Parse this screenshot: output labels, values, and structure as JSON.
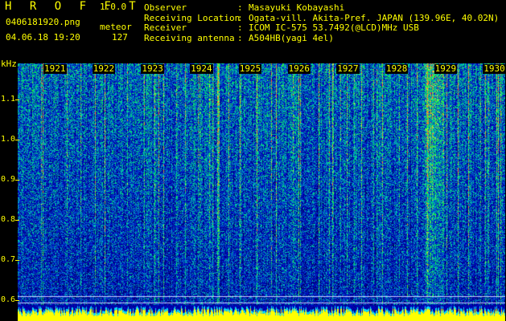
{
  "app": {
    "title": "H R O F F T",
    "version": "1.0.0"
  },
  "file": {
    "name": "0406181920.png",
    "datetime": "04.06.18 19:20",
    "mode": "meteor",
    "count": "127"
  },
  "info": [
    {
      "key": "Observer",
      "value": "Masayuki Kobayashi"
    },
    {
      "key": "Receiving Location",
      "value": "Ogata-vill. Akita-Pref. JAPAN (139.96E, 40.02N)"
    },
    {
      "key": "Receiver",
      "value": "ICOM IC-575 53.7492(@LCD)MHz USB"
    },
    {
      "key": "Receiving antenna",
      "value": "A504HB(yagi 4el)"
    }
  ],
  "y_axis": {
    "unit": "kHz",
    "ticks": [
      "1.1",
      "1.0",
      "0.9",
      "0.8",
      "0.7",
      "0.6"
    ]
  },
  "x_axis": {
    "ticks": [
      "1921",
      "1922",
      "1923",
      "1924",
      "1925",
      "1926",
      "1927",
      "1928",
      "1929",
      "1930"
    ]
  },
  "colors": {
    "text": "#ffff00",
    "background": "#000000"
  }
}
